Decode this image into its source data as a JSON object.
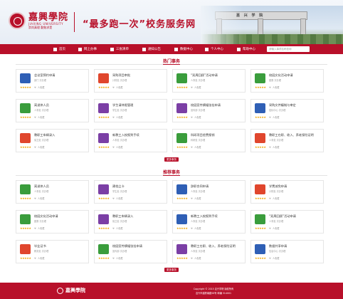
{
  "header": {
    "logo_cn": "嘉興學院",
    "logo_en": "JIAXING UNIVERSITY",
    "logo_motto": "崇尚真理 勤勉求是",
    "site_title": "“最多跑一次”校务服务网",
    "gate_text": "嘉 兴 学 院"
  },
  "nav": {
    "items": [
      {
        "label": "首页",
        "icon": "home-icon"
      },
      {
        "label": "网上办事",
        "icon": "monitor-icon"
      },
      {
        "label": "三张清单",
        "icon": "list-icon"
      },
      {
        "label": "通知公告",
        "icon": "megaphone-icon"
      },
      {
        "label": "数据中心",
        "icon": "chart-icon"
      },
      {
        "label": "个人中心",
        "icon": "user-icon"
      },
      {
        "label": "帮助中心",
        "icon": "help-icon"
      }
    ],
    "search_placeholder": "请输入事项名称查询"
  },
  "hot": {
    "title": "热门事务",
    "more": "更多事务",
    "cards": [
      {
        "title": "会议室预约申请",
        "meta1": "部门",
        "meta2": "次办理",
        "fav": "人收藏",
        "icon": "building-icon",
        "color": "#2f5fb5"
      },
      {
        "title": "采购项目审批",
        "meta1": "计财处",
        "meta2": "次办理",
        "fav": "人收藏",
        "icon": "bag-icon",
        "color": "#e0462d"
      },
      {
        "title": "“双周回顾”活动申请",
        "meta1": "人事处",
        "meta2": "次办理",
        "fav": "人收藏",
        "icon": "refresh-icon",
        "color": "#3a9d3c"
      },
      {
        "title": "校园文化活动申请",
        "meta1": "团委",
        "meta2": "次办理",
        "fav": "人收藏",
        "icon": "people-icon",
        "color": "#3a9d3c"
      },
      {
        "title": "离退休人员",
        "meta1": "人事处",
        "meta2": "次办理",
        "fav": "人收藏",
        "icon": "book-icon",
        "color": "#3a9d3c"
      },
      {
        "title": "学生请休假管理",
        "meta1": "学生处",
        "meta2": "次办理",
        "fav": "人收藏",
        "icon": "shield-icon",
        "color": "#7b3fa5"
      },
      {
        "title": "校园宣传横幅张挂申请",
        "meta1": "宣传部",
        "meta2": "次办理",
        "fav": "人收藏",
        "icon": "flag-icon",
        "color": "#7b3fa5"
      },
      {
        "title": "采购文件编制与审定",
        "meta1": "招标中心",
        "meta2": "次办理",
        "fav": "人收藏",
        "icon": "basket-icon",
        "color": "#2f5fb5"
      },
      {
        "title": "教职工车辆录入",
        "meta1": "保卫处",
        "meta2": "次办理",
        "fav": "人收藏",
        "icon": "person-icon",
        "color": "#e0462d"
      },
      {
        "title": "新教工入校报到手续",
        "meta1": "人事处",
        "meta2": "次办理",
        "fav": "人收藏",
        "icon": "shield-icon",
        "color": "#7b3fa5"
      },
      {
        "title": "科研项目经费报销",
        "meta1": "科研处",
        "meta2": "次办理",
        "fav": "人收藏",
        "icon": "atom-icon",
        "color": "#3a9d3c"
      },
      {
        "title": "教职工在职、收入、养老保险证明",
        "meta1": "人事处",
        "meta2": "次办理",
        "fav": "人收藏",
        "icon": "document-icon",
        "color": "#e0462d"
      }
    ]
  },
  "recommend": {
    "title": "推荐事务",
    "more": "更多事务",
    "cards": [
      {
        "title": "离退休人员",
        "meta1": "人事处",
        "meta2": "次办理",
        "fav": "人收藏",
        "icon": "book-icon",
        "color": "#3a9d3c"
      },
      {
        "title": "建档立卡",
        "meta1": "学生处",
        "meta2": "次办理",
        "fav": "人收藏",
        "icon": "document-icon",
        "color": "#7b3fa5"
      },
      {
        "title": "辞职合同申请",
        "meta1": "人事处",
        "meta2": "次办理",
        "fav": "人收藏",
        "icon": "chart-icon",
        "color": "#2f5fb5"
      },
      {
        "title": "学费减免申请",
        "meta1": "计财处",
        "meta2": "次办理",
        "fav": "人收藏",
        "icon": "money-icon",
        "color": "#e0462d"
      },
      {
        "title": "校园文化活动申请",
        "meta1": "团委",
        "meta2": "次办理",
        "fav": "人收藏",
        "icon": "people-icon",
        "color": "#3a9d3c"
      },
      {
        "title": "教职工车辆录入",
        "meta1": "保卫处",
        "meta2": "次办理",
        "fav": "人收藏",
        "icon": "person-icon",
        "color": "#7b3fa5"
      },
      {
        "title": "新教工入校报到手续",
        "meta1": "人事处",
        "meta2": "次办理",
        "fav": "人收藏",
        "icon": "chart-icon",
        "color": "#2f5fb5"
      },
      {
        "title": "“双周回顾”活动申请",
        "meta1": "人事处",
        "meta2": "次办理",
        "fav": "人收藏",
        "icon": "refresh-icon",
        "color": "#3a9d3c"
      },
      {
        "title": "毕业证书",
        "meta1": "教务处",
        "meta2": "次办理",
        "fav": "人收藏",
        "icon": "certificate-icon",
        "color": "#e0462d"
      },
      {
        "title": "校园宣传横幅张挂申请",
        "meta1": "宣传部",
        "meta2": "次办理",
        "fav": "人收藏",
        "icon": "flag-icon",
        "color": "#3a9d3c"
      },
      {
        "title": "教职工在职、收入、养老保险证明",
        "meta1": "人事处",
        "meta2": "次办理",
        "fav": "人收藏",
        "icon": "document-icon",
        "color": "#7b3fa5"
      },
      {
        "title": "数据共享申请",
        "meta1": "信息中心",
        "meta2": "次办理",
        "fav": "人收藏",
        "icon": "cloud-icon",
        "color": "#2f5fb5"
      }
    ]
  },
  "footer": {
    "logo": "嘉興學院",
    "copyright": "Copyright © 2015 嘉兴学院 版权所有",
    "address": "嘉兴市越秀南路56号 邮编 314001"
  },
  "colors": {
    "brand": "#b8102a",
    "star": "#f0a400"
  }
}
